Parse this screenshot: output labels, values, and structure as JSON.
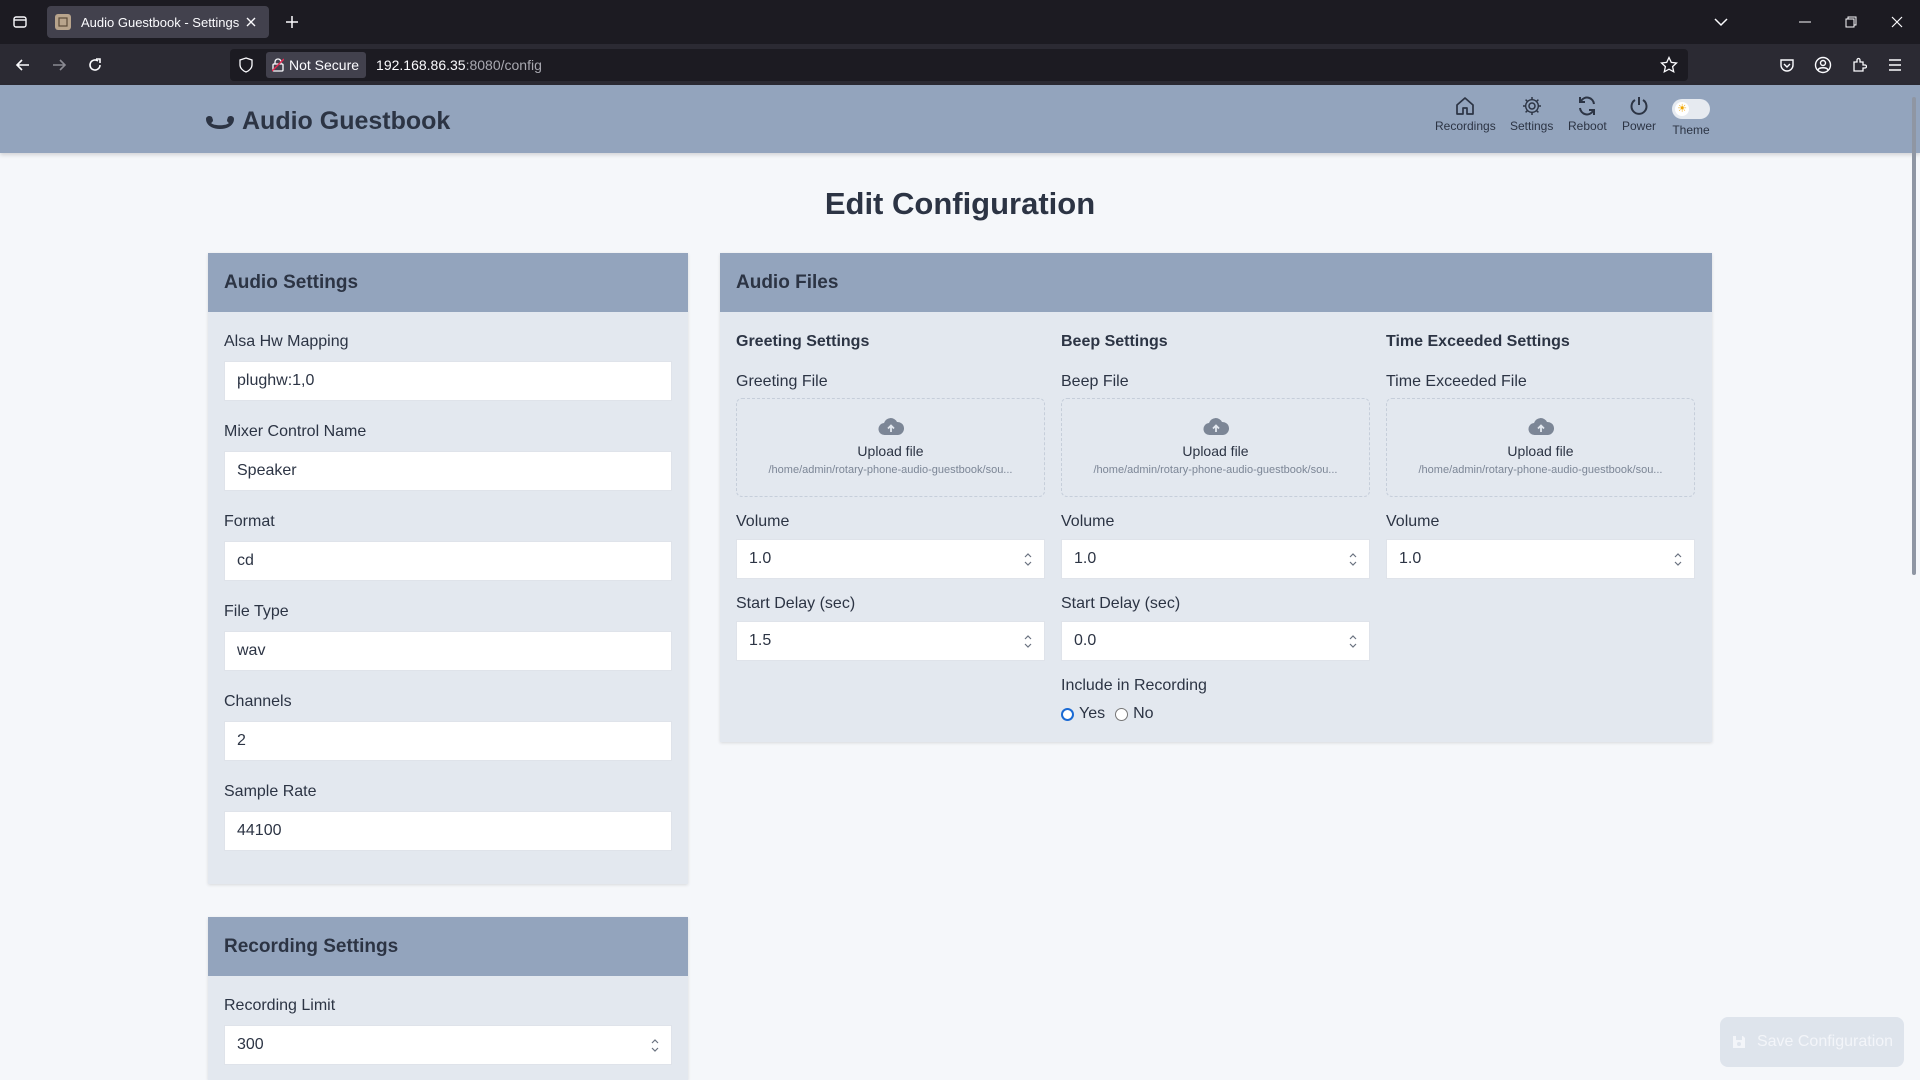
{
  "browser": {
    "tab_title": "Audio Guestbook - Settings",
    "security_label": "Not Secure",
    "url_host": "192.168.86.35",
    "url_rest": ":8080/config"
  },
  "header": {
    "brand": "Audio Guestbook",
    "nav": {
      "recordings": "Recordings",
      "settings": "Settings",
      "reboot": "Reboot",
      "power": "Power",
      "theme": "Theme"
    }
  },
  "page": {
    "title": "Edit Configuration"
  },
  "audio_settings": {
    "title": "Audio Settings",
    "fields": [
      {
        "label": "Alsa Hw Mapping",
        "value": "plughw:1,0"
      },
      {
        "label": "Mixer Control Name",
        "value": "Speaker"
      },
      {
        "label": "Format",
        "value": "cd"
      },
      {
        "label": "File Type",
        "value": "wav"
      },
      {
        "label": "Channels",
        "value": "2"
      },
      {
        "label": "Sample Rate",
        "value": "44100"
      }
    ]
  },
  "recording_settings": {
    "title": "Recording Settings",
    "limit_label": "Recording Limit",
    "limit_value": "300"
  },
  "audio_files": {
    "title": "Audio Files",
    "upload_label": "Upload file",
    "volume_label": "Volume",
    "delay_label": "Start Delay (sec)",
    "greeting": {
      "title": "Greeting Settings",
      "file_label": "Greeting File",
      "path": "/home/admin/rotary-phone-audio-guestbook/sou...",
      "volume": "1.0",
      "delay": "1.5"
    },
    "beep": {
      "title": "Beep Settings",
      "file_label": "Beep File",
      "path": "/home/admin/rotary-phone-audio-guestbook/sou...",
      "volume": "1.0",
      "delay": "0.0",
      "include_label": "Include in Recording",
      "yes_label": "Yes",
      "no_label": "No",
      "include_selected": "Yes"
    },
    "time_exceeded": {
      "title": "Time Exceeded Settings",
      "file_label": "Time Exceeded File",
      "path": "/home/admin/rotary-phone-audio-guestbook/sou...",
      "volume": "1.0"
    }
  },
  "save_button": "Save Configuration"
}
